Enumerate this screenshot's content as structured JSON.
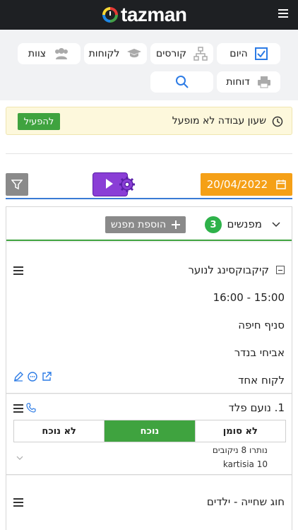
{
  "header": {
    "logo_text": "tazman"
  },
  "nav": {
    "today": "היום",
    "courses": "קורסים",
    "customers": "לקוחות",
    "team": "צוות",
    "reports": "דוחות"
  },
  "banner": {
    "text": "שעון עבודה לא מופעל",
    "activate_label": "להפעיל"
  },
  "toolbar": {
    "date": "20/04/2022"
  },
  "entrants": {
    "label": "מפנשים",
    "count": "3",
    "add_label": "הוספת מפנש"
  },
  "lesson": {
    "title": "קיקבוקסינג לנוער",
    "time": "15:00 - 16:00",
    "branch": "סניף חיפה",
    "instructor": "אביחי בנדר",
    "customers": "לקוח אחד"
  },
  "participant": {
    "name": "1. נועם פלד",
    "status_options": [
      "לא סומן",
      "נוכח",
      "לא נוכח"
    ],
    "active_status": "נוכח",
    "remaining": "נותרו 8 ניקובים",
    "card": "kartisia 10"
  },
  "lesson2": {
    "title": "חוג שחייה - ילדים"
  },
  "colors": {
    "accent_blue": "#2c7be5",
    "green": "#3fa33f",
    "orange": "#f5a017",
    "purple": "#8a3ed6"
  }
}
